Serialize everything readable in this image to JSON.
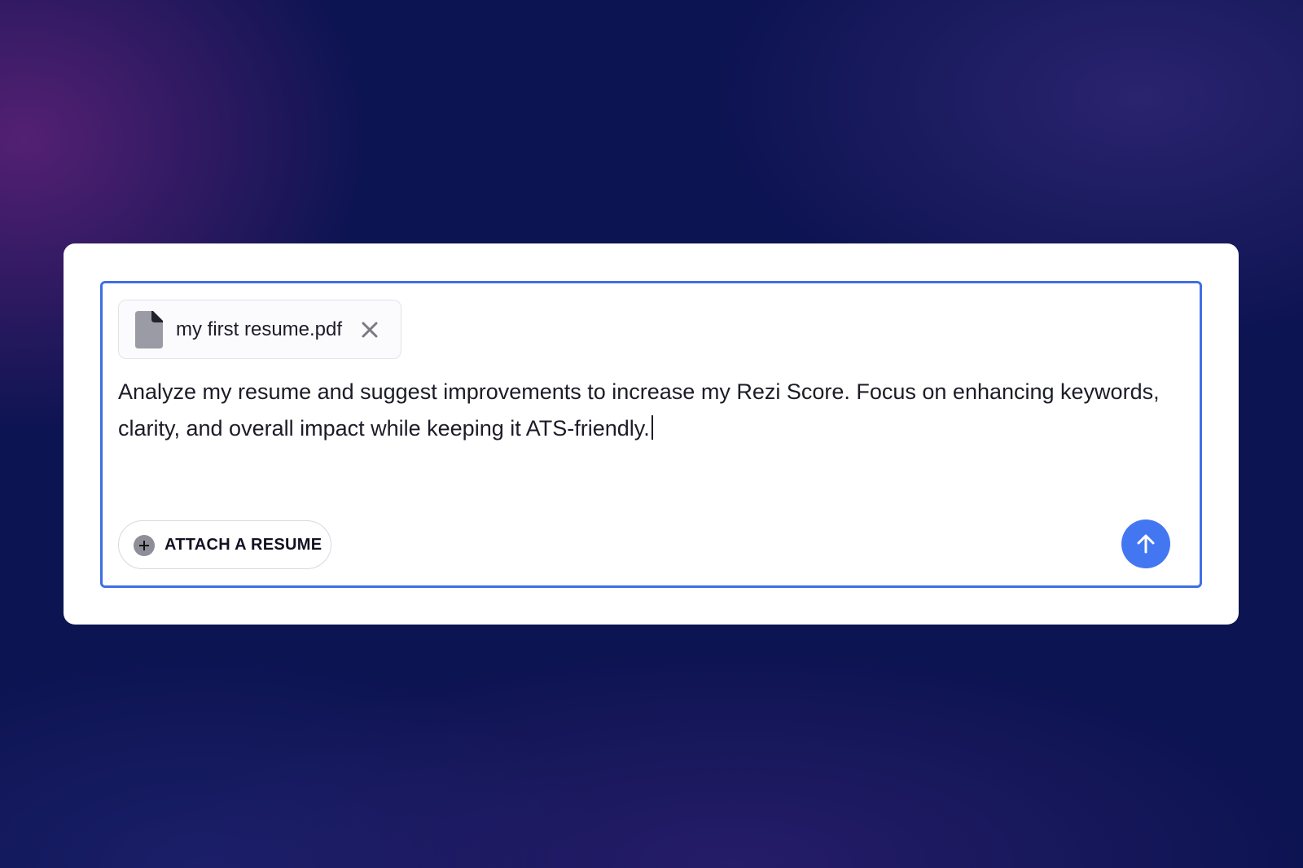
{
  "composer": {
    "attachment": {
      "file_name": "my first resume.pdf",
      "icon": "file-icon",
      "remove_icon": "close-icon"
    },
    "message_text": "Analyze my resume and suggest improvements to increase my Rezi Score. Focus on enhancing keywords, clarity, and overall impact while keeping it ATS-friendly.",
    "attach_button": {
      "label": "ATTACH A RESUME",
      "icon": "plus-icon"
    },
    "send_button": {
      "icon": "arrow-up-icon"
    }
  },
  "colors": {
    "accent": "#3f6ee6",
    "send_button": "#4377f2",
    "background": "#0d1452"
  }
}
